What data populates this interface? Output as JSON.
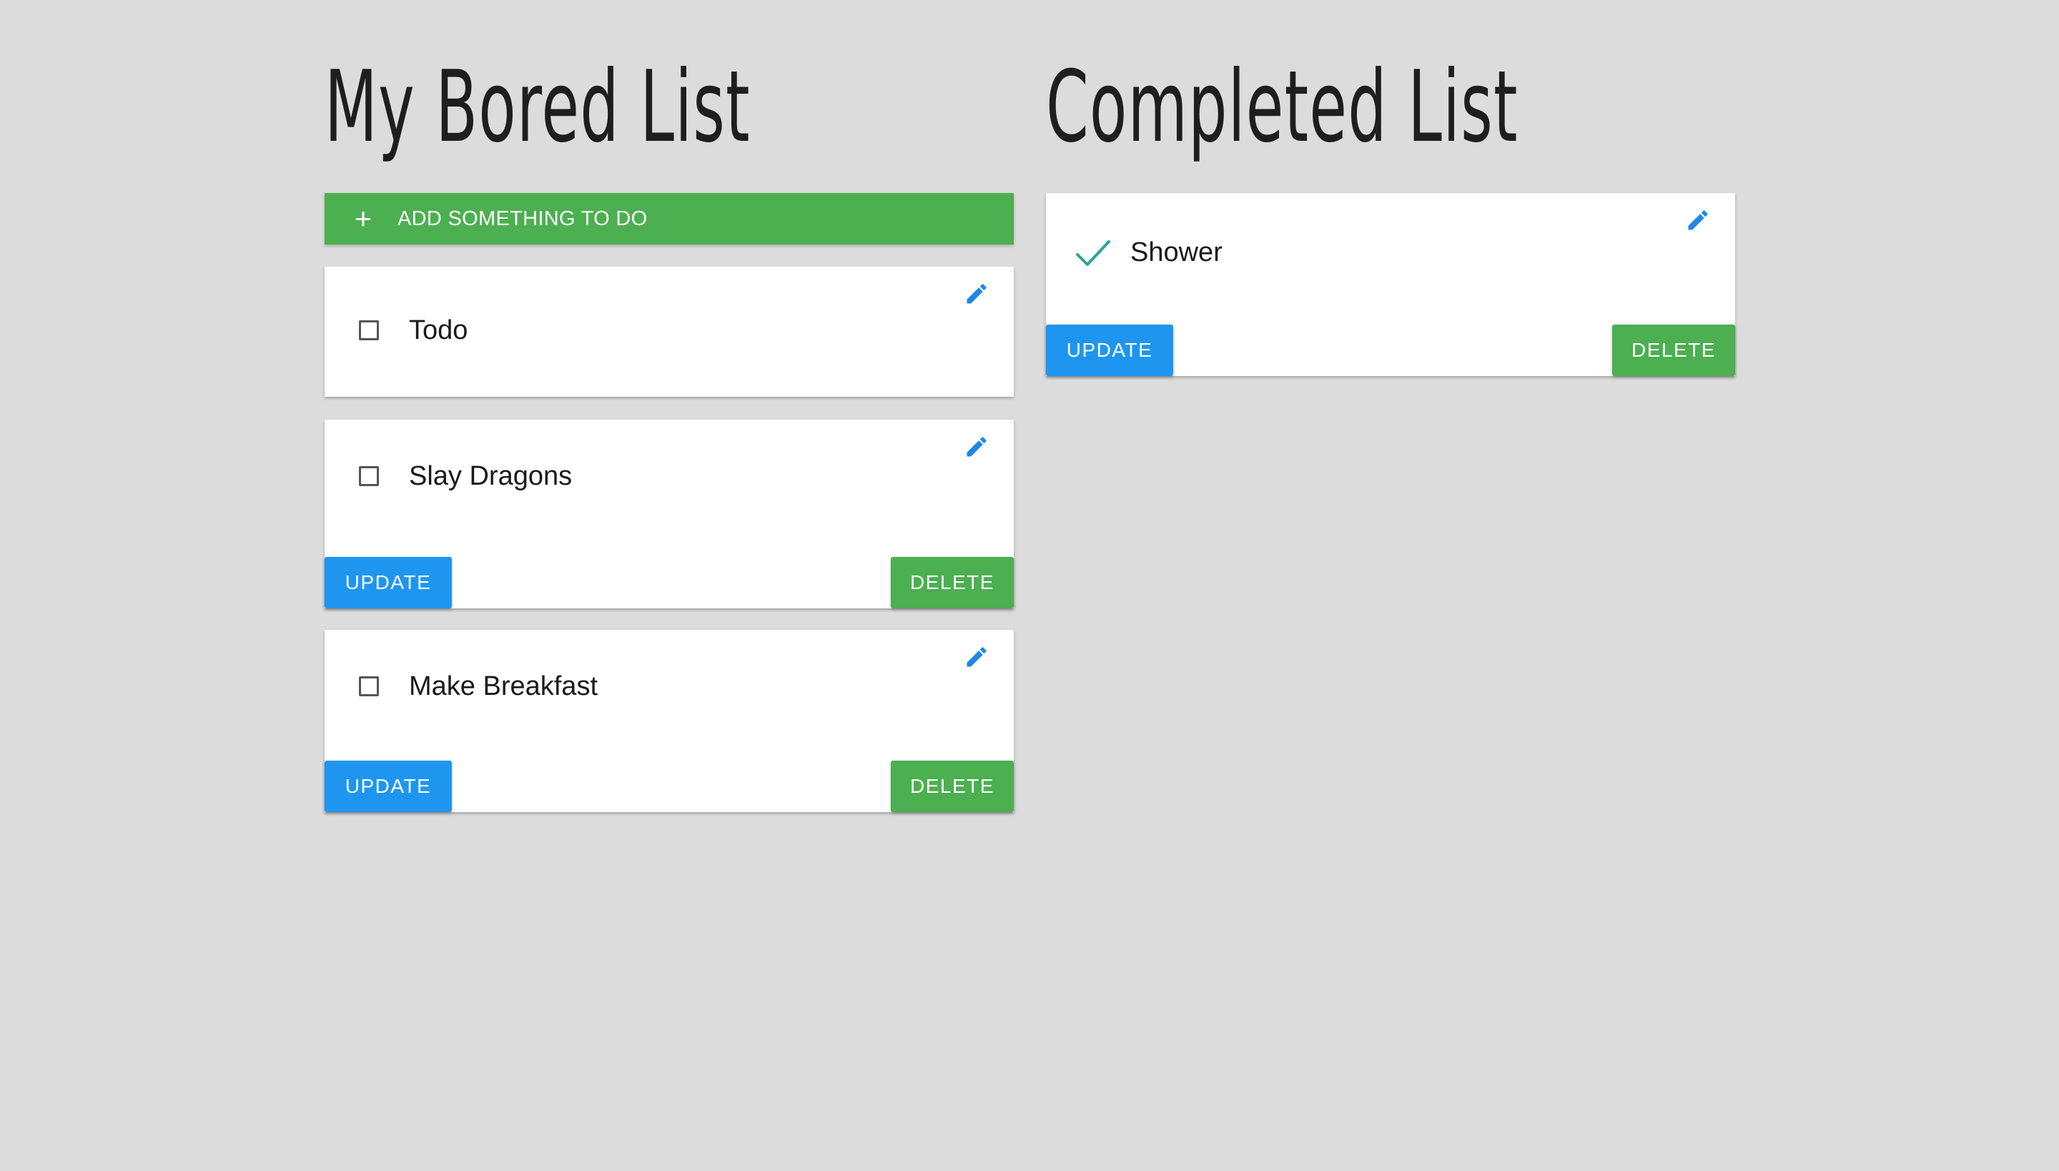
{
  "todo_list": {
    "title": "My Bored List",
    "add_button": {
      "icon": "plus-icon",
      "icon_glyph": "+",
      "label": "ADD SOMETHING TO DO"
    },
    "items": [
      {
        "text": "Todo",
        "checked": false,
        "update_label": "",
        "delete_label": ""
      },
      {
        "text": "Slay Dragons",
        "checked": false,
        "update_label": "UPDATE",
        "delete_label": "DELETE"
      },
      {
        "text": "Make Breakfast",
        "checked": false,
        "update_label": "UPDATE",
        "delete_label": "DELETE"
      }
    ]
  },
  "completed_list": {
    "title": "Completed List",
    "items": [
      {
        "text": "Shower",
        "checked": true,
        "update_label": "UPDATE",
        "delete_label": "DELETE"
      }
    ]
  },
  "colors": {
    "background": "#dcdcdc",
    "card": "#ffffff",
    "primary_green": "#4caf50",
    "update_blue": "#1e96f0",
    "edit_icon_blue": "#1e88e5",
    "check_teal": "#26a69a",
    "text": "#1a1a1a"
  },
  "icons": {
    "edit": "pencil-icon",
    "unchecked": "checkbox-unchecked-icon",
    "checked": "checkmark-icon"
  }
}
